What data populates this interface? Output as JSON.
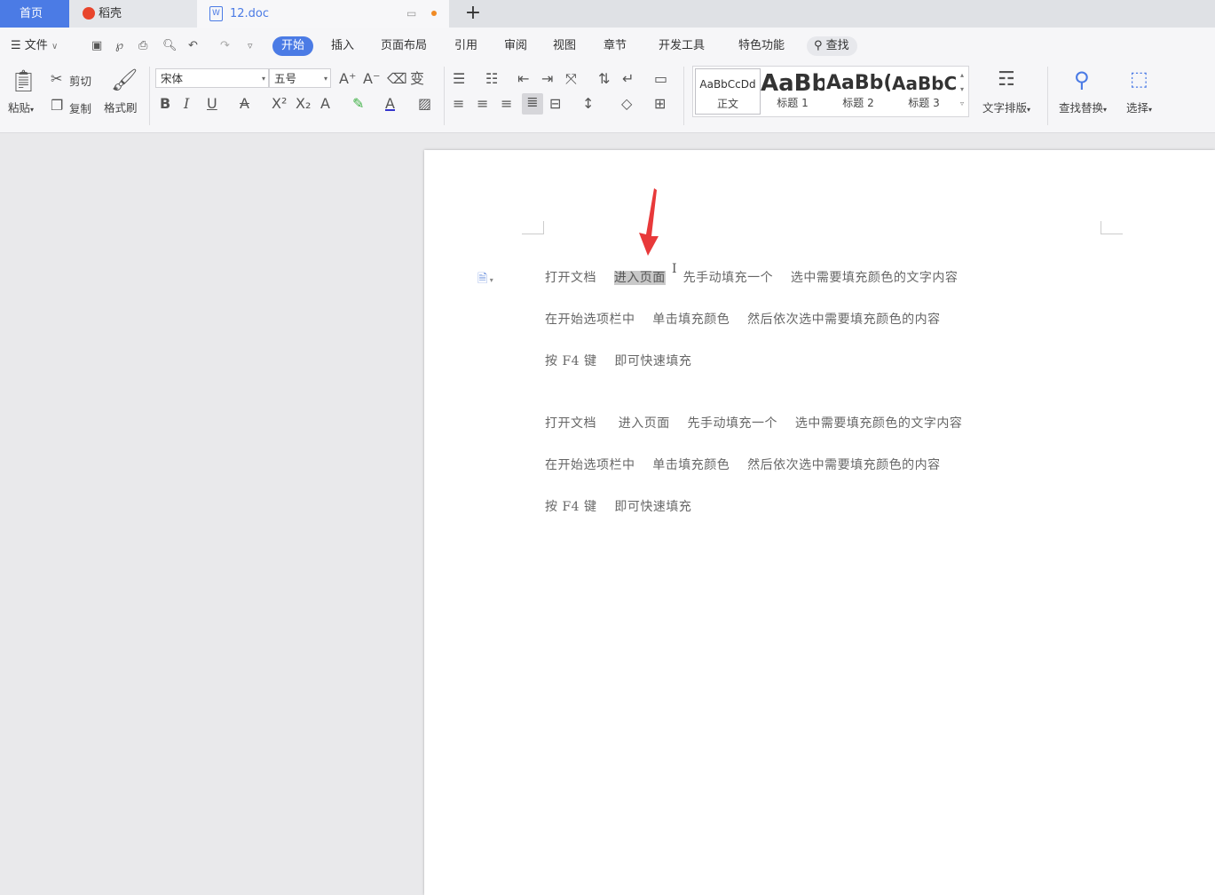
{
  "tabs": {
    "home": "首页",
    "daoke": "稻壳",
    "doc": "12.doc",
    "add": "+"
  },
  "menu": {
    "file": "文件",
    "items": [
      "开始",
      "插入",
      "页面布局",
      "引用",
      "审阅",
      "视图",
      "章节",
      "开发工具",
      "特色功能"
    ],
    "search": "查找"
  },
  "ribbon": {
    "paste": "粘贴",
    "cut": "剪切",
    "copy": "复制",
    "format_painter": "格式刷",
    "font_name": "宋体",
    "font_size": "五号",
    "styles": [
      {
        "preview": "AaBbCcDd",
        "label": "正文"
      },
      {
        "preview": "AaBb",
        "label": "标题 1"
      },
      {
        "preview": "AaBb(",
        "label": "标题 2"
      },
      {
        "preview": "AaBbC(",
        "label": "标题 3"
      }
    ],
    "text_layout": "文字排版",
    "find_replace": "查找替换",
    "select": "选择"
  },
  "document": {
    "paragraphs": [
      {
        "before": "打开文档    ",
        "highlight": "进入页面",
        "after": "    先手动填充一个    选中需要填充颜色的文字内容"
      },
      {
        "before": "在开始选项栏中    单击填充颜色    然后依次选中需要填充颜色的内容",
        "highlight": "",
        "after": ""
      },
      {
        "before": "按 F4 键    即可快速填充",
        "highlight": "",
        "after": ""
      },
      {
        "before": "打开文档     进入页面    先手动填充一个    选中需要填充颜色的文字内容",
        "highlight": "",
        "after": ""
      },
      {
        "before": "在开始选项栏中    单击填充颜色    然后依次选中需要填充颜色的内容",
        "highlight": "",
        "after": ""
      },
      {
        "before": "按 F4 键    即可快速填充",
        "highlight": "",
        "after": ""
      }
    ]
  },
  "colors": {
    "accent": "#4b7be5",
    "arrow": "#e8393a",
    "daoke_icon": "#e8452c"
  }
}
